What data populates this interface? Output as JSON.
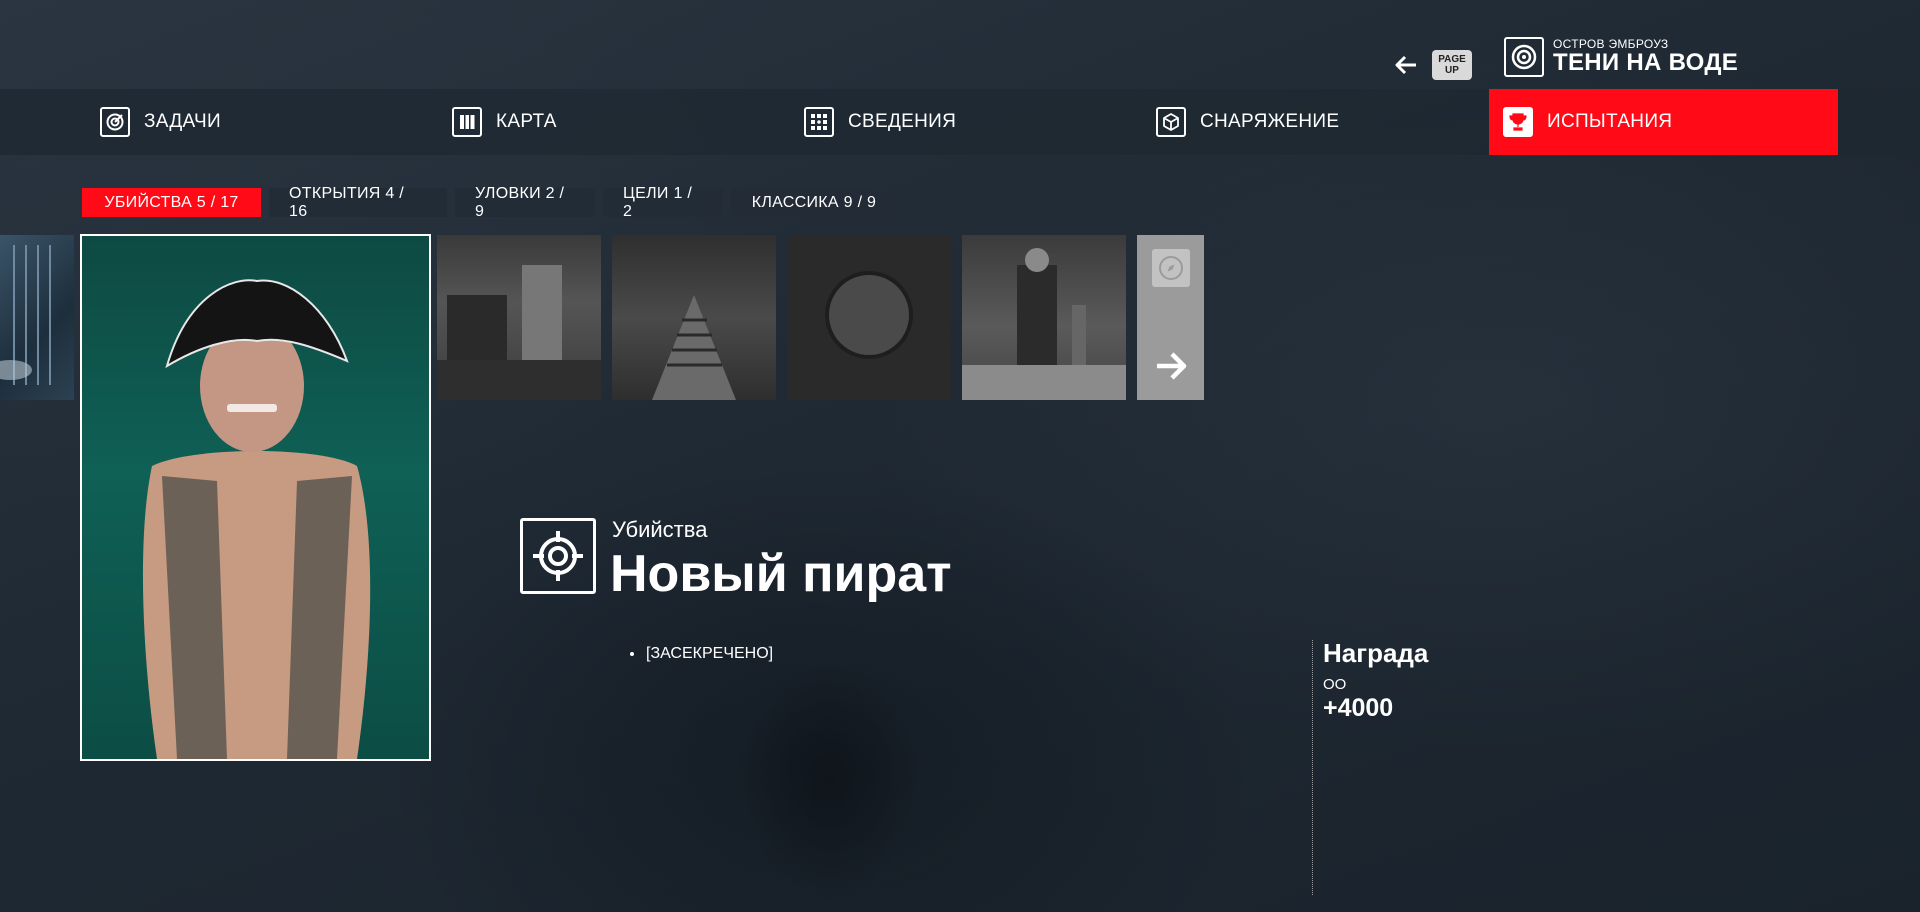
{
  "header": {
    "pageup_key": [
      "PAGE",
      "UP"
    ],
    "location_subtitle": "ОСТРОВ ЭМБРОУЗ",
    "location_title": "ТЕНИ НА ВОДЕ"
  },
  "nav": {
    "items": [
      {
        "label": "ЗАДАЧИ",
        "icon": "target-icon"
      },
      {
        "label": "КАРТА",
        "icon": "map-icon"
      },
      {
        "label": "СВЕДЕНИЯ",
        "icon": "intel-icon"
      },
      {
        "label": "СНАРЯЖЕНИЕ",
        "icon": "box-icon"
      },
      {
        "label": "ИСПЫТАНИЯ",
        "icon": "trophy-icon",
        "active": true
      }
    ],
    "accent_color": "#ff0a16"
  },
  "subtabs": [
    {
      "label": "УБИЙСТВА  5 / 17",
      "active": true
    },
    {
      "label": "ОТКРЫТИЯ  4 / 16"
    },
    {
      "label": "УЛОВКИ  2 / 9"
    },
    {
      "label": "ЦЕЛИ  1 / 2"
    },
    {
      "label": "КЛАССИКА  9 / 9"
    }
  ],
  "detail": {
    "category": "Убийства",
    "title": "Новый пират",
    "description": "[ЗАСЕКРЕЧЕНО]",
    "reward": {
      "heading": "Награда",
      "sub": "ОО",
      "value": "+4000"
    }
  }
}
